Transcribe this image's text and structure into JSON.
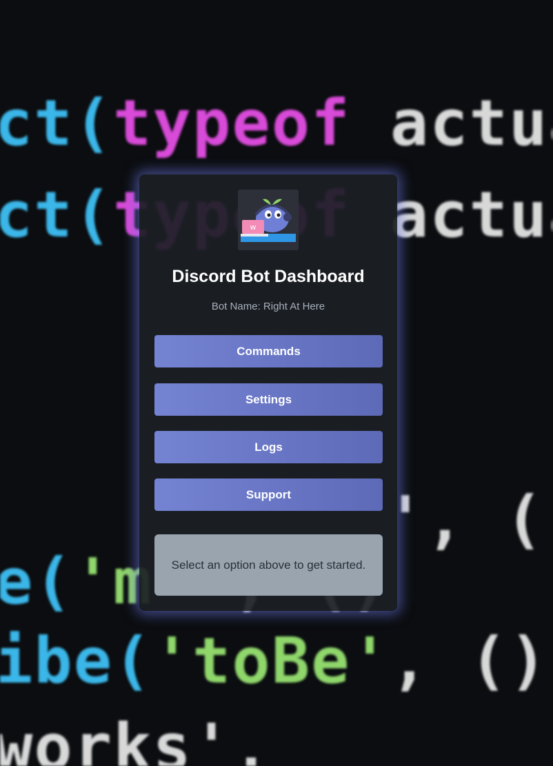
{
  "dashboard": {
    "title": "Discord Bot Dashboard",
    "bot_name_text": "Bot Name: Right At Here"
  },
  "menu": [
    {
      "label": "Commands"
    },
    {
      "label": "Settings"
    },
    {
      "label": "Logs"
    },
    {
      "label": "Support"
    }
  ],
  "info_text": "Select an option above to get started.",
  "colors": {
    "accent": "#6f7cd0",
    "card_glow": "#6e78e6",
    "info_panel": "#99a4ae"
  },
  "icons": {
    "logo": "bot-mascot-icon"
  }
}
